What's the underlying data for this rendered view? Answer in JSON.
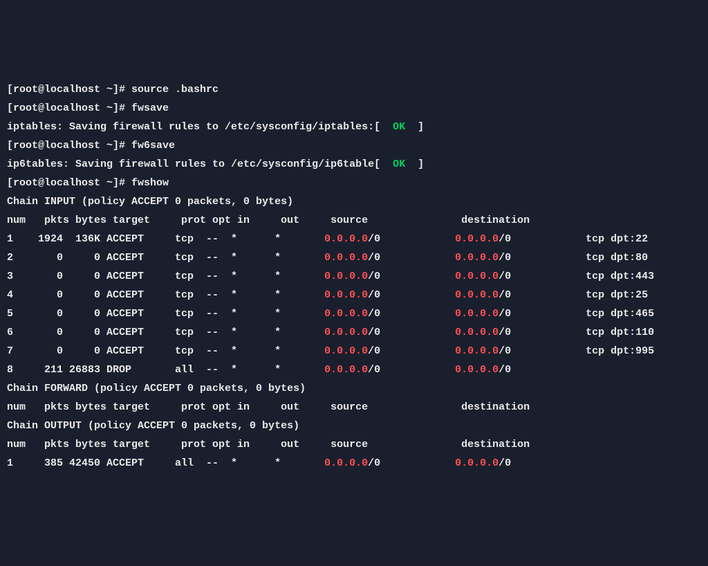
{
  "prompt": "[root@localhost ~]#",
  "commands": {
    "c1": "source .bashrc",
    "c2": "fwsave",
    "c3": "fw6save",
    "c4": "fwshow"
  },
  "save4_pre": "iptables: Saving firewall rules to /etc/sysconfig/iptables:[",
  "save6_pre": "ip6tables: Saving firewall rules to /etc/sysconfig/ip6table[",
  "ok": "  OK  ",
  "save_post": "]",
  "chains": {
    "input_header": "Chain INPUT (policy ACCEPT 0 packets, 0 bytes)",
    "forward_header": "Chain FORWARD (policy ACCEPT 0 packets, 0 bytes)",
    "output_header": "Chain OUTPUT (policy ACCEPT 0 packets, 0 bytes)",
    "col_header": "num   pkts bytes target     prot opt in     out     source               destination"
  },
  "ip_red": "0.0.0.0",
  "ip_suffix": "/0",
  "rows": {
    "input": [
      {
        "num": "1",
        "pkts": "1924",
        "bytes": "136K",
        "target": "ACCEPT",
        "prot": "tcp",
        "opt": "--",
        "in": "*",
        "out": "*",
        "extra": "tcp dpt:22"
      },
      {
        "num": "2",
        "pkts": "0",
        "bytes": "0",
        "target": "ACCEPT",
        "prot": "tcp",
        "opt": "--",
        "in": "*",
        "out": "*",
        "extra": "tcp dpt:80"
      },
      {
        "num": "3",
        "pkts": "0",
        "bytes": "0",
        "target": "ACCEPT",
        "prot": "tcp",
        "opt": "--",
        "in": "*",
        "out": "*",
        "extra": "tcp dpt:443"
      },
      {
        "num": "4",
        "pkts": "0",
        "bytes": "0",
        "target": "ACCEPT",
        "prot": "tcp",
        "opt": "--",
        "in": "*",
        "out": "*",
        "extra": "tcp dpt:25"
      },
      {
        "num": "5",
        "pkts": "0",
        "bytes": "0",
        "target": "ACCEPT",
        "prot": "tcp",
        "opt": "--",
        "in": "*",
        "out": "*",
        "extra": "tcp dpt:465"
      },
      {
        "num": "6",
        "pkts": "0",
        "bytes": "0",
        "target": "ACCEPT",
        "prot": "tcp",
        "opt": "--",
        "in": "*",
        "out": "*",
        "extra": "tcp dpt:110"
      },
      {
        "num": "7",
        "pkts": "0",
        "bytes": "0",
        "target": "ACCEPT",
        "prot": "tcp",
        "opt": "--",
        "in": "*",
        "out": "*",
        "extra": "tcp dpt:995"
      },
      {
        "num": "8",
        "pkts": "211",
        "bytes": "26883",
        "target": "DROP",
        "prot": "all",
        "opt": "--",
        "in": "*",
        "out": "*",
        "extra": ""
      }
    ],
    "output": [
      {
        "num": "1",
        "pkts": "385",
        "bytes": "42450",
        "target": "ACCEPT",
        "prot": "all",
        "opt": "--",
        "in": "*",
        "out": "*",
        "extra": ""
      }
    ]
  }
}
